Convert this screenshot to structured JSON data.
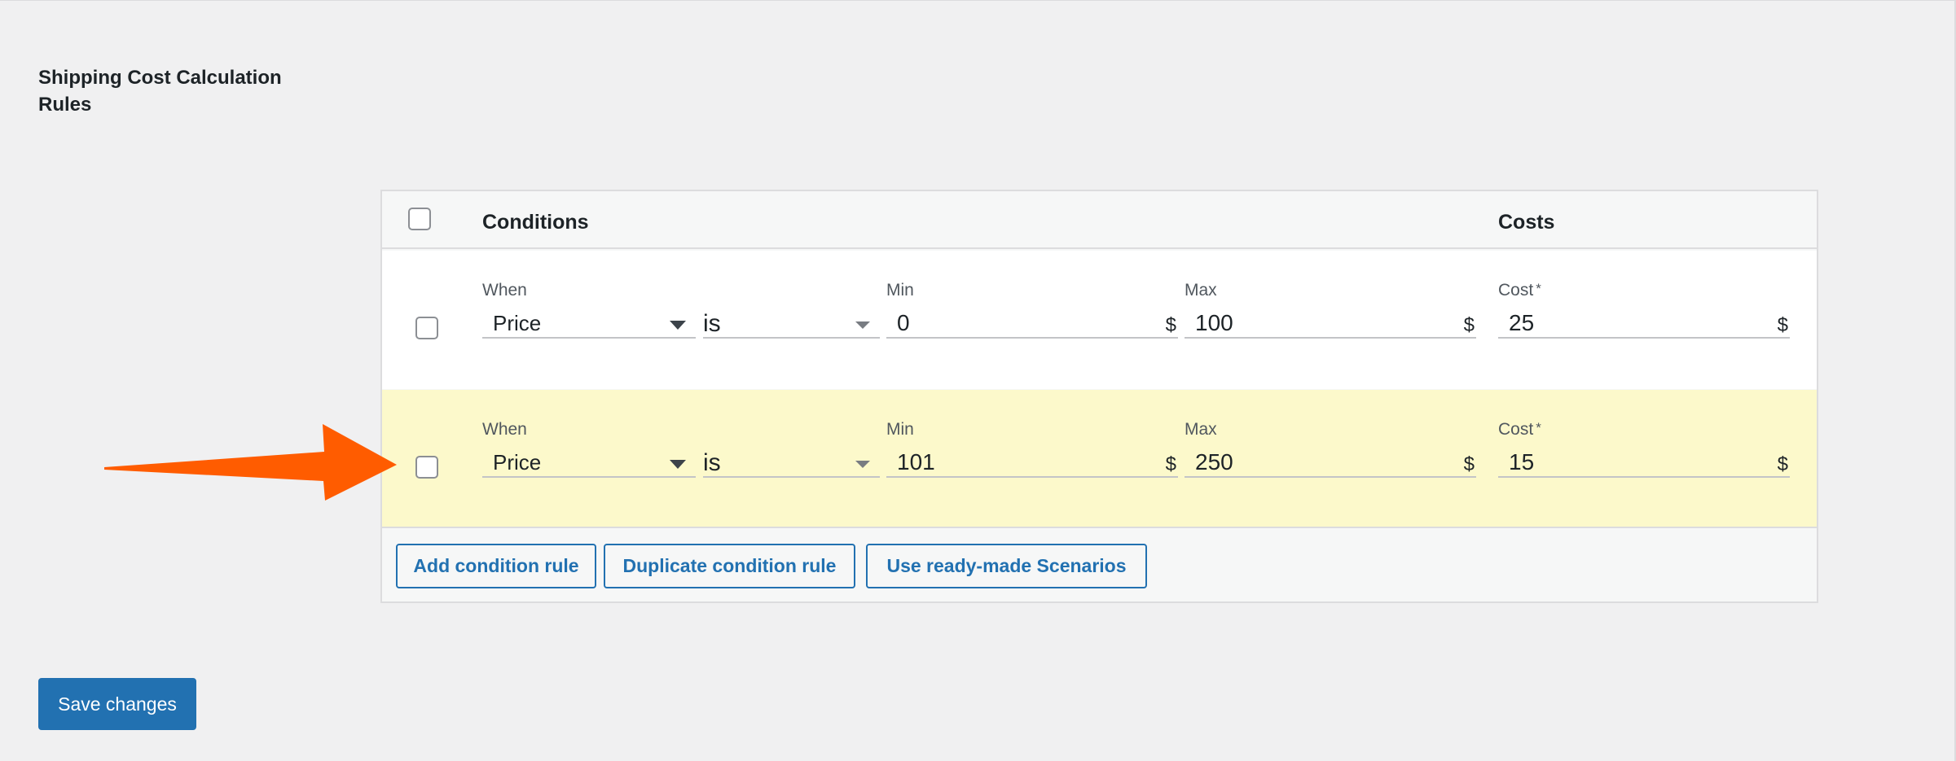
{
  "section": {
    "title": "Shipping Cost Calculation Rules"
  },
  "table": {
    "headers": {
      "conditions": "Conditions",
      "costs": "Costs"
    }
  },
  "labels": {
    "when": "When",
    "min": "Min",
    "max": "Max",
    "cost": "Cost",
    "required_mark": "*",
    "currency": "$"
  },
  "rows": [
    {
      "when": "Price",
      "operator": "is",
      "min": "0",
      "max": "100",
      "cost": "25",
      "highlighted": false
    },
    {
      "when": "Price",
      "operator": "is",
      "min": "101",
      "max": "250",
      "cost": "15",
      "highlighted": true
    }
  ],
  "buttons": {
    "add": "Add condition rule",
    "duplicate": "Duplicate condition rule",
    "scenarios": "Use ready-made Scenarios"
  },
  "save": {
    "label": "Save changes"
  },
  "colors": {
    "accent": "#2271b1",
    "highlight_row": "#fcf9cb",
    "arrow": "#ff5c00",
    "background": "#f0f0f1"
  }
}
